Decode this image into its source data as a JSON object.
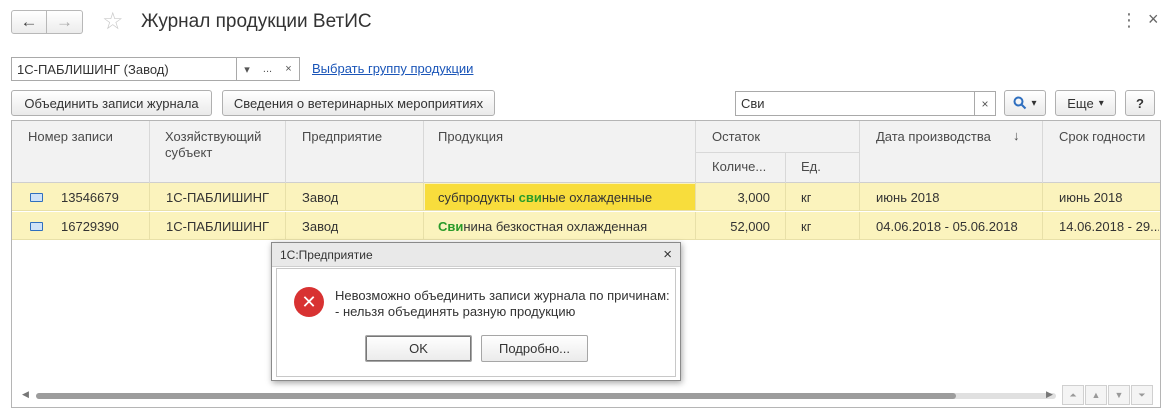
{
  "window": {
    "title": "Журнал продукции ВетИС",
    "nav_back": "←",
    "nav_forward": "→",
    "favorite_glyph": "☆",
    "more_glyph": "⋮",
    "close_glyph": "×"
  },
  "filter": {
    "organization_value": "1С-ПАБЛИШИНГ (Завод)",
    "dropdown_glyph": "▾",
    "select_glyph": "...",
    "clear_glyph": "×",
    "group_link": "Выбрать группу продукции"
  },
  "toolbar": {
    "merge_button": "Объединить записи журнала",
    "vet_info_button": "Сведения о ветеринарных мероприятиях",
    "search_value": "Сви",
    "search_clear": "×",
    "search_glyph": "🔍",
    "search_dropdown": "▾",
    "more_button": "Еще",
    "more_dropdown": "▾",
    "help_button": "?"
  },
  "table": {
    "headers": {
      "record_no": "Номер записи",
      "entity": "Хозяйствующий субъект",
      "enterprise": "Предприятие",
      "product": "Продукция",
      "balance": "Остаток",
      "quantity": "Количе...",
      "unit": "Ед.",
      "production_date": "Дата производства",
      "sort_arrow": "↓",
      "expiry": "Срок годности"
    },
    "rows": [
      {
        "record_no": "13546679",
        "entity": "1С-ПАБЛИШИНГ",
        "enterprise": "Завод",
        "product_pre": "субпродукты ",
        "product_match": "сви",
        "product_post": "ные охлажденные",
        "quantity": "3,000",
        "unit": "кг",
        "production_date": "июнь 2018",
        "expiry": "июнь 2018"
      },
      {
        "record_no": "16729390",
        "entity": "1С-ПАБЛИШИНГ",
        "enterprise": "Завод",
        "product_pre": "",
        "product_match": "Сви",
        "product_post": "нина безкостная охлажденная",
        "quantity": "52,000",
        "unit": "кг",
        "production_date": "04.06.2018 - 05.06.2018",
        "expiry": "14.06.2018 - 29..."
      }
    ]
  },
  "pager": {
    "first": "⏶",
    "prev": "▲",
    "next": "▼",
    "last": "⏷",
    "scroll_left": "◀",
    "scroll_right": "▶"
  },
  "dialog": {
    "title": "1С:Предприятие",
    "close_glyph": "×",
    "icon_glyph": "✕",
    "message_line1": "Невозможно объединить записи журнала по причинам:",
    "message_line2": "- нельзя объединять разную продукцию",
    "ok_button": "OK",
    "details_button": "Подробно..."
  },
  "colors": {
    "row_background": "#fbf3bd",
    "selected_cell": "#f8dd3c",
    "search_match": "#2a9b2a",
    "link": "#1a55b8",
    "error_icon": "#d83232"
  }
}
